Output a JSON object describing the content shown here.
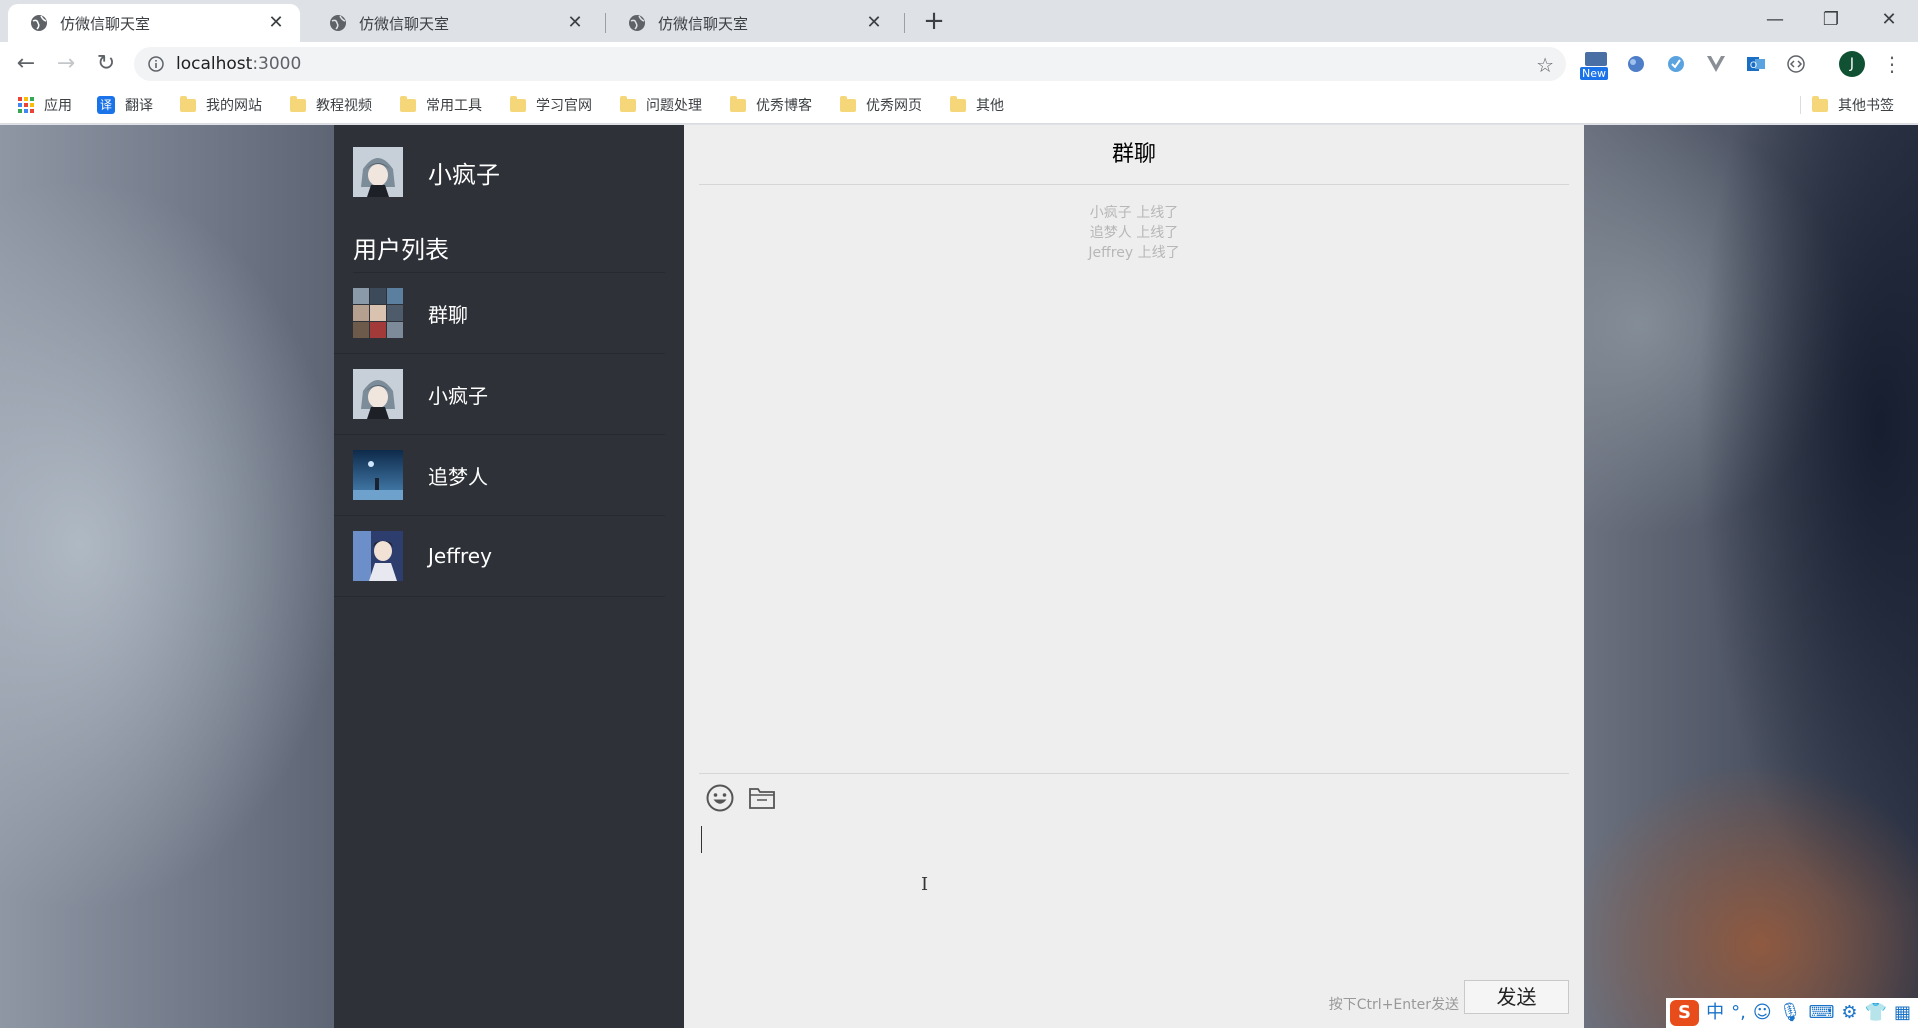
{
  "browser": {
    "tabs": [
      {
        "title": "仿微信聊天室",
        "active": true
      },
      {
        "title": "仿微信聊天室",
        "active": false
      },
      {
        "title": "仿微信聊天室",
        "active": false
      }
    ],
    "new_tab": "+",
    "window_controls": {
      "minimize": "—",
      "restore": "❐",
      "close": "✕"
    },
    "url_host": "localhost",
    "url_port": ":3000",
    "extension_new_badge": "New",
    "profile_initial": "J",
    "bookmarks": [
      {
        "label": "应用",
        "icon": "apps-grid-icon"
      },
      {
        "label": "翻译",
        "icon": "translate-icon",
        "glyph": "译"
      },
      {
        "label": "我的网站",
        "icon": "folder-icon"
      },
      {
        "label": "教程视频",
        "icon": "folder-icon"
      },
      {
        "label": "常用工具",
        "icon": "folder-icon"
      },
      {
        "label": "学习官网",
        "icon": "folder-icon"
      },
      {
        "label": "问题处理",
        "icon": "folder-icon"
      },
      {
        "label": "优秀博客",
        "icon": "folder-icon"
      },
      {
        "label": "优秀网页",
        "icon": "folder-icon"
      },
      {
        "label": "其他",
        "icon": "folder-icon"
      }
    ],
    "other_bookmarks": "其他书签"
  },
  "chat": {
    "me": {
      "name": "小疯子"
    },
    "user_list_title": "用户列表",
    "users": [
      {
        "name": "群聊"
      },
      {
        "name": "小疯子"
      },
      {
        "name": "追梦人"
      },
      {
        "name": "Jeffrey"
      }
    ],
    "title": "群聊",
    "system_messages": [
      "小疯子 上线了",
      "追梦人 上线了",
      "Jeffrey 上线了"
    ],
    "send_hint": "按下Ctrl+Enter发送",
    "send_label": "发送"
  },
  "ime": {
    "logo": "S",
    "mode": "中",
    "punct": "°,"
  },
  "colors": {
    "sidebar_bg": "#2e3238",
    "main_bg": "#eeeeee",
    "system_text": "#b7b7b7"
  }
}
